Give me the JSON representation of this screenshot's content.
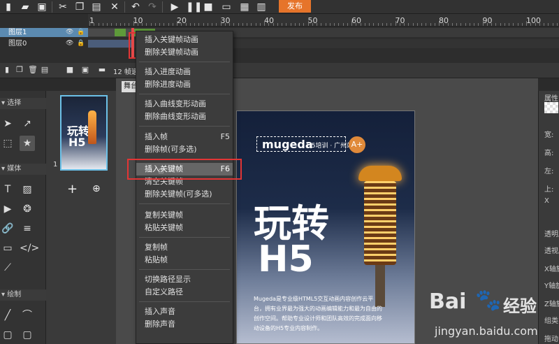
{
  "toolbar": {
    "publish_label": "发布",
    "icons": [
      "new-file-icon",
      "open-file-icon",
      "save-icon",
      "cut-icon",
      "copy-icon",
      "paste-icon",
      "delete-icon",
      "undo-icon",
      "redo-icon",
      "play-icon",
      "pause-icon",
      "preview-icon",
      "qr-code-icon",
      "record-icon",
      "layout-icon"
    ]
  },
  "timeline": {
    "ruler_labels": [
      "1",
      "10",
      "20",
      "30",
      "40",
      "50",
      "60",
      "70",
      "80",
      "90",
      "100"
    ],
    "layers": [
      {
        "name": "图层1",
        "selected": true
      },
      {
        "name": "图层0",
        "selected": false
      }
    ]
  },
  "toolbar2": {
    "fps_text": "12 帧速"
  },
  "tools": {
    "select_section": "选择",
    "media_section": "媒体",
    "draw_section": "绘制"
  },
  "thumbs": {
    "page_number": "1",
    "add_label": "+"
  },
  "stage": {
    "tab_label": "舞台",
    "logo_text": "mugeda",
    "subtitle": "H5培训 · 广州站",
    "badge": "A+",
    "title_cn": "玩转",
    "title_en": "H5",
    "body_text": "Mugeda是专业级HTML5交互动画内容创作云平台，拥有业界最为强大的动画编辑能力和最为自由的创作空间。帮助专业设计师和团队高效的完成面向移动设备的H5专业内容制作。"
  },
  "context_menu": {
    "items": [
      {
        "label": "插入关键帧动画",
        "key": ""
      },
      {
        "label": "删除关键帧动画",
        "key": ""
      },
      {
        "label": "插入进度动画",
        "key": ""
      },
      {
        "label": "删除进度动画",
        "key": ""
      },
      {
        "label": "插入曲线变形动画",
        "key": ""
      },
      {
        "label": "删除曲线变形动画",
        "key": ""
      },
      {
        "label": "插入帧",
        "key": "F5"
      },
      {
        "label": "删除帧(可多选)",
        "key": ""
      },
      {
        "label": "插入关键帧",
        "key": "F6",
        "highlighted": true
      },
      {
        "label": "清空关键帧",
        "key": ""
      },
      {
        "label": "删除关键帧(可多选)",
        "key": ""
      },
      {
        "label": "复制关键帧",
        "key": ""
      },
      {
        "label": "粘贴关键帧",
        "key": ""
      },
      {
        "label": "复制帧",
        "key": ""
      },
      {
        "label": "粘贴帧",
        "key": ""
      },
      {
        "label": "切换路径显示",
        "key": ""
      },
      {
        "label": "自定义路径",
        "key": ""
      },
      {
        "label": "插入声音",
        "key": ""
      },
      {
        "label": "删除声音",
        "key": ""
      }
    ]
  },
  "properties": {
    "title": "属性",
    "fields": [
      "宽:",
      "高:",
      "左:",
      "上:",
      "X",
      "透明度",
      "透视度",
      "X轴旋",
      "Y轴旋",
      "Z轴旋",
      "组类",
      "拖动"
    ]
  },
  "watermark": {
    "brand": "Bai",
    "brand_cn": "经验",
    "url": "jingyan.baidu.com"
  },
  "colors": {
    "accent": "#e6742a",
    "highlight_box": "#e23535",
    "selection": "#6cc1e8"
  }
}
